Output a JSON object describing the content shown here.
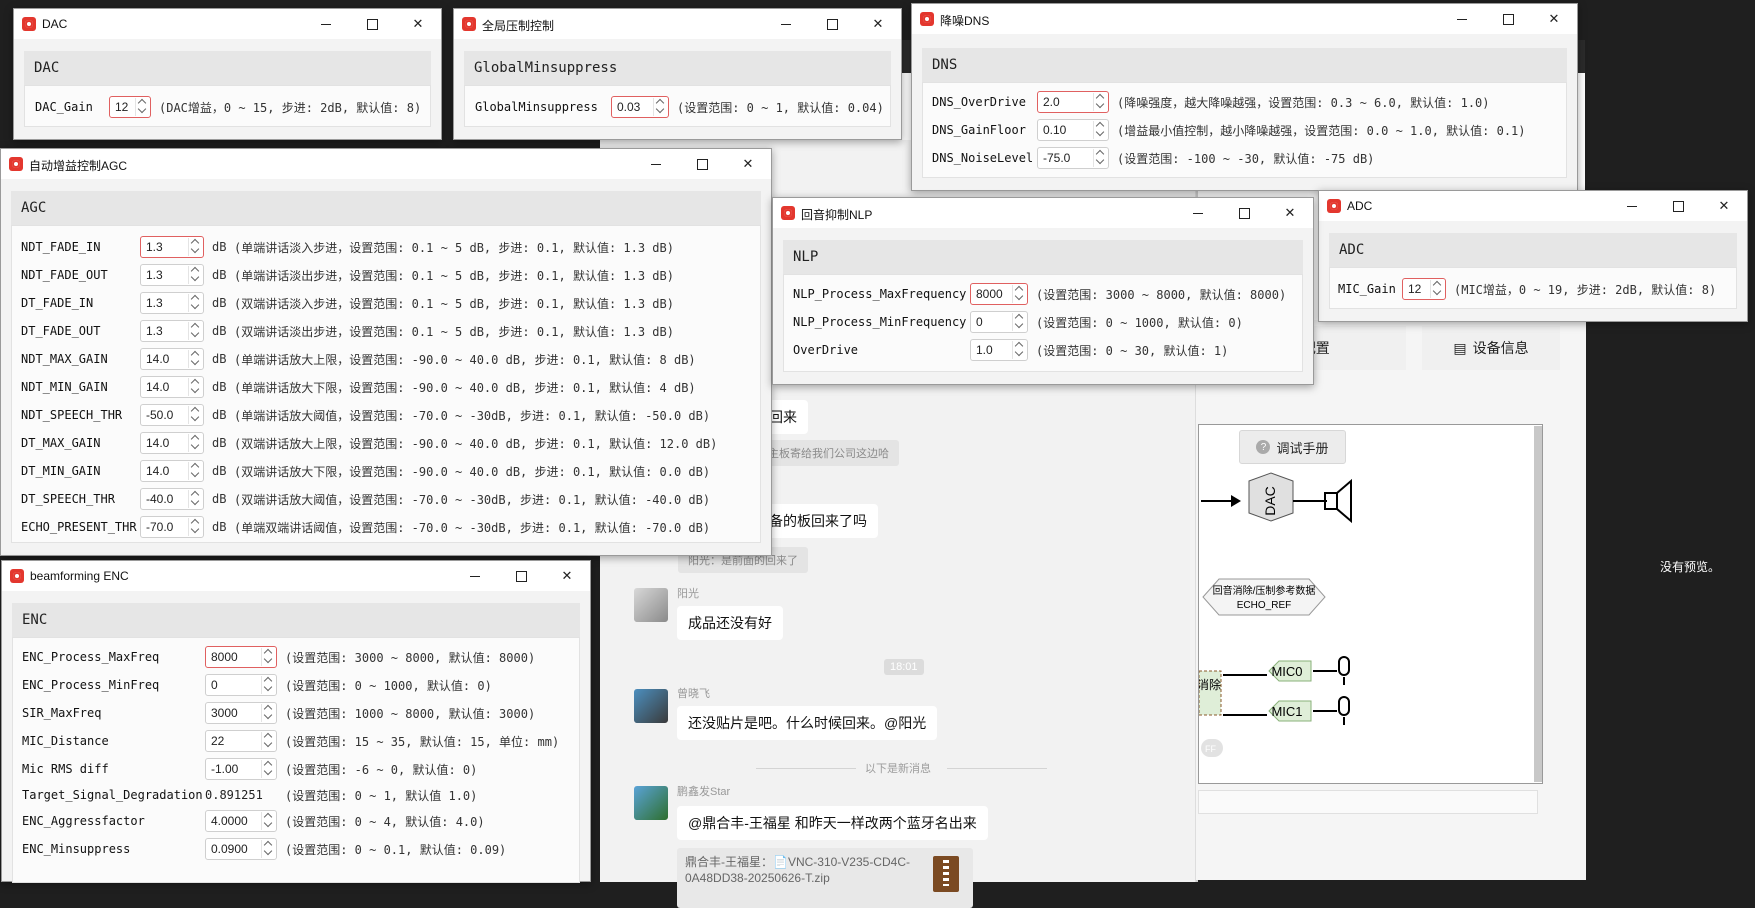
{
  "background": {
    "chat": [
      {
        "type": "bubble",
        "text": "回来"
      },
      {
        "type": "gray",
        "text": "主板寄给我们公司这边哈"
      },
      {
        "type": "bubble",
        "text": "备的板回来了吗"
      },
      {
        "type": "gray",
        "text": "阳光：是前面的回来了"
      },
      {
        "type": "message",
        "sender": "阳光",
        "text": "成品还没有好"
      },
      {
        "type": "timestamp",
        "text": "18:01"
      },
      {
        "type": "message",
        "sender": "曾晓飞",
        "text": "还没贴片是吧。什么时候回来。@阳光"
      },
      {
        "type": "divider",
        "text": "以下是新消息"
      },
      {
        "type": "message",
        "sender": "鹏鑫发Star",
        "text": "@鼎合丰-王福星 和昨天一样改两个蓝牙名出来"
      },
      {
        "type": "file",
        "text": "鼎合丰-王福星：📄VNC-310-V235-CD4C-0A48DD38-20250626-T.zip"
      }
    ],
    "tabs": [
      "ANC配置",
      "设备信息"
    ],
    "manual_button": "调试手册",
    "diagram": {
      "dac": "DAC",
      "echo_ref_cn": "回音消除/压制参考数据",
      "echo_ref": "ECHO_REF",
      "mic0": "MIC0",
      "mic1": "MIC1",
      "left_block": "消除\nC",
      "toggle": "FF"
    },
    "preview": "没有预览。"
  },
  "windows": {
    "dac": {
      "title": "DAC",
      "group": "DAC",
      "params": [
        {
          "name": "DAC_Gain",
          "value": "12",
          "desc": "(DAC增益，0 ~ 15, 步进: 2dB, 默认值: 8)"
        }
      ]
    },
    "global": {
      "title": "全局压制控制",
      "group": "GlobalMinsuppress",
      "params": [
        {
          "name": "GlobalMinsuppress",
          "value": "0.03",
          "desc": "(设置范围: 0 ~ 1, 默认值: 0.04)"
        }
      ]
    },
    "dns": {
      "title": "降噪DNS",
      "group": "DNS",
      "params": [
        {
          "name": "DNS_OverDrive",
          "value": "2.0",
          "desc": "(降噪强度，越大降噪越强，设置范围: 0.3 ~ 6.0, 默认值: 1.0)"
        },
        {
          "name": "DNS_GainFloor",
          "value": "0.10",
          "desc": "(增益最小值控制，越小降噪越强，设置范围: 0.0 ~ 1.0, 默认值: 0.1)"
        },
        {
          "name": "DNS_NoiseLevel",
          "value": "-75.0",
          "desc": "(设置范围: -100 ~ -30, 默认值: -75 dB)"
        }
      ]
    },
    "agc": {
      "title": "自动增益控制AGC",
      "group": "AGC",
      "params": [
        {
          "name": "NDT_FADE_IN",
          "value": "1.3",
          "unit": "dB",
          "desc": "(单端讲话淡入步进，设置范围: 0.1 ~ 5 dB, 步进: 0.1, 默认值: 1.3 dB)"
        },
        {
          "name": "NDT_FADE_OUT",
          "value": "1.3",
          "unit": "dB",
          "desc": "(单端讲话淡出步进，设置范围: 0.1 ~ 5 dB, 步进: 0.1, 默认值: 1.3 dB)"
        },
        {
          "name": "DT_FADE_IN",
          "value": "1.3",
          "unit": "dB",
          "desc": "(双端讲话淡入步进，设置范围: 0.1 ~ 5 dB, 步进: 0.1, 默认值: 1.3 dB)"
        },
        {
          "name": "DT_FADE_OUT",
          "value": "1.3",
          "unit": "dB",
          "desc": "(双端讲话淡出步进，设置范围: 0.1 ~ 5 dB, 步进: 0.1, 默认值: 1.3 dB)"
        },
        {
          "name": "NDT_MAX_GAIN",
          "value": "14.0",
          "unit": "dB",
          "desc": "(单端讲话放大上限，设置范围: -90.0 ~ 40.0 dB, 步进: 0.1,  默认值: 8 dB)"
        },
        {
          "name": "NDT_MIN_GAIN",
          "value": "14.0",
          "unit": "dB",
          "desc": "(单端讲话放大下限，设置范围: -90.0 ~ 40.0 dB, 步进: 0.1,  默认值: 4 dB)"
        },
        {
          "name": "NDT_SPEECH_THR",
          "value": "-50.0",
          "unit": "dB",
          "desc": "(单端讲话放大阈值，设置范围: -70.0 ~ -30dB, 步进: 0.1, 默认值: -50.0 dB)"
        },
        {
          "name": "DT_MAX_GAIN",
          "value": "14.0",
          "unit": "dB",
          "desc": "(双端讲话放大上限，设置范围: -90.0 ~ 40.0 dB, 步进: 0.1,  默认值: 12.0 dB)"
        },
        {
          "name": "DT_MIN_GAIN",
          "value": "14.0",
          "unit": "dB",
          "desc": "(双端讲话放大下限，设置范围: -90.0 ~ 40.0 dB, 步进: 0.1,  默认值: 0.0 dB)"
        },
        {
          "name": "DT_SPEECH_THR",
          "value": "-40.0",
          "unit": "dB",
          "desc": "(双端讲话放大阈值，设置范围: -70.0 ~ -30dB, 步进: 0.1, 默认值: -40.0 dB)"
        },
        {
          "name": "ECHO_PRESENT_THR",
          "value": "-70.0",
          "unit": "dB",
          "desc": "(单端双端讲话阈值，设置范围: -70.0 ~ -30dB, 步进: 0.1, 默认值: -70.0 dB)"
        }
      ]
    },
    "nlp": {
      "title": "回音抑制NLP",
      "group": "NLP",
      "params": [
        {
          "name": "NLP_Process_MaxFrequency",
          "value": "8000",
          "desc": "(设置范围: 3000 ~ 8000, 默认值: 8000)"
        },
        {
          "name": "NLP_Process_MinFrequency",
          "value": "0",
          "desc": "(设置范围: 0 ~ 1000, 默认值: 0)"
        },
        {
          "name": "OverDrive",
          "value": "1.0",
          "desc": "(设置范围: 0 ~ 30, 默认值: 1)"
        }
      ]
    },
    "adc": {
      "title": "ADC",
      "group": "ADC",
      "params": [
        {
          "name": "MIC_Gain",
          "value": "12",
          "desc": "(MIC增益，0 ~ 19, 步进: 2dB, 默认值: 8)"
        }
      ]
    },
    "enc": {
      "title": "beamforming ENC",
      "group": "ENC",
      "params": [
        {
          "name": "ENC_Process_MaxFreq",
          "value": "8000",
          "desc": "(设置范围: 3000 ~ 8000, 默认值: 8000)"
        },
        {
          "name": "ENC_Process_MinFreq",
          "value": "0",
          "desc": "(设置范围: 0 ~ 1000, 默认值: 0)"
        },
        {
          "name": "SIR_MaxFreq",
          "value": "3000",
          "desc": "(设置范围: 1000 ~ 8000, 默认值: 3000)"
        },
        {
          "name": "MIC_Distance",
          "value": "22",
          "desc": "(设置范围: 15 ~ 35, 默认值: 15, 单位: mm)"
        },
        {
          "name": "Mic RMS diff",
          "value": "-1.00",
          "desc": "(设置范围: -6 ~ 0, 默认值: 0)"
        },
        {
          "name": "Target_Signal_Degradation",
          "value": "0.891251",
          "desc": "(设置范围: 0 ~ 1, 默认值 1.0)"
        },
        {
          "name": "ENC_Aggressfactor",
          "value": "4.0000",
          "desc": "(设置范围: 0 ~ 4, 默认值: 4.0)"
        },
        {
          "name": "ENC_Minsuppress",
          "value": "0.0900",
          "desc": "(设置范围: 0 ~ 0.1, 默认值: 0.09)"
        }
      ]
    }
  }
}
